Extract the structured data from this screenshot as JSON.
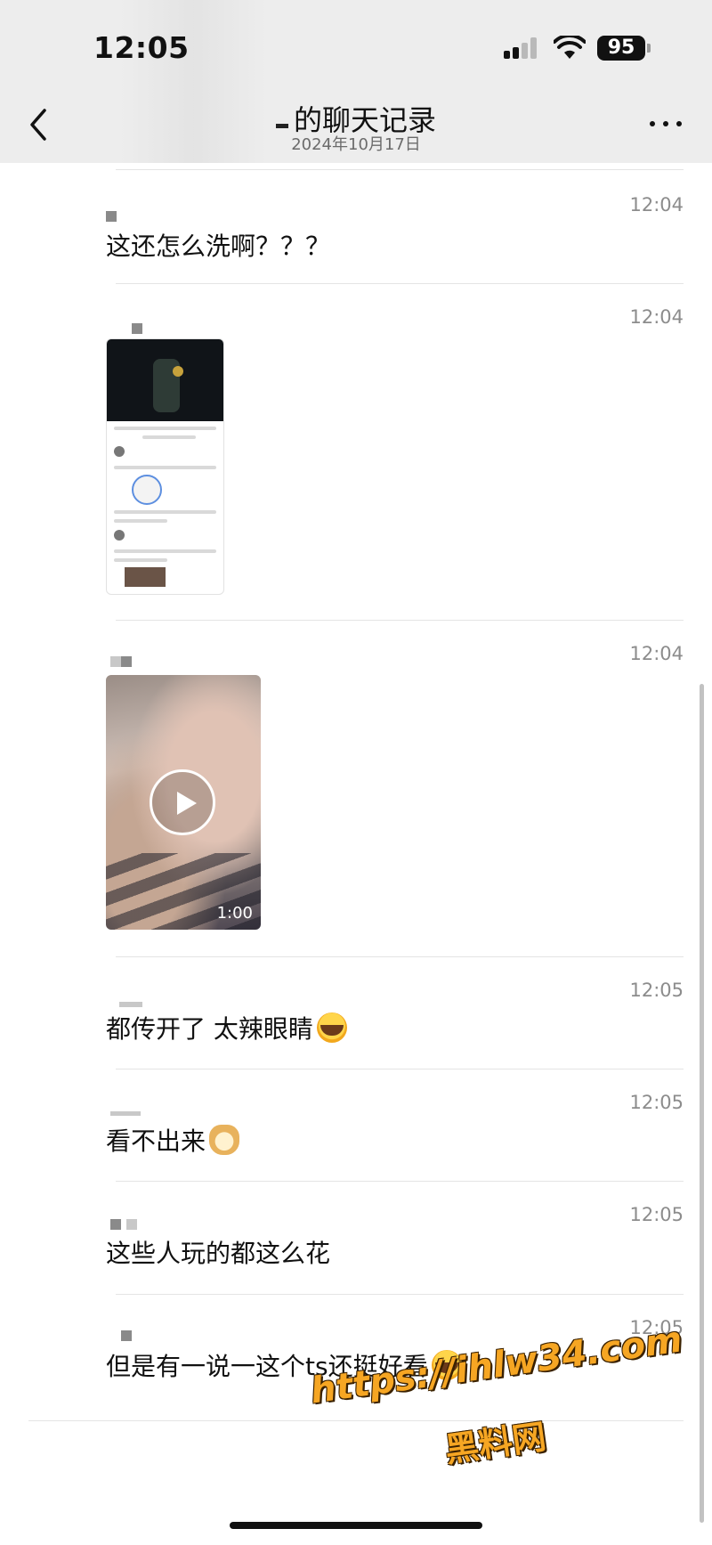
{
  "status_bar": {
    "time": "12:05",
    "battery": "95"
  },
  "nav": {
    "title": "的聊天记录",
    "subtitle": "2024年10月17日"
  },
  "messages": [
    {
      "time": "12:04",
      "text": "这还怎么洗啊？？？"
    },
    {
      "time": "12:04",
      "type": "image"
    },
    {
      "time": "12:04",
      "type": "video",
      "duration": "1:00"
    },
    {
      "time": "12:05",
      "text": "都传开了 太辣眼睛",
      "emoji": "laughing-crying-emoji"
    },
    {
      "time": "12:05",
      "text": "看不出来",
      "emoji": "doge-emoji"
    },
    {
      "time": "12:05",
      "text": "这些人玩的都这么花"
    },
    {
      "time": "12:05",
      "text": "但是有一说一这个ts还挺好看",
      "emoji": "laughing-crying-emoji"
    }
  ],
  "watermark": {
    "url": "https://ihlw34.com",
    "name": "黑料网"
  }
}
